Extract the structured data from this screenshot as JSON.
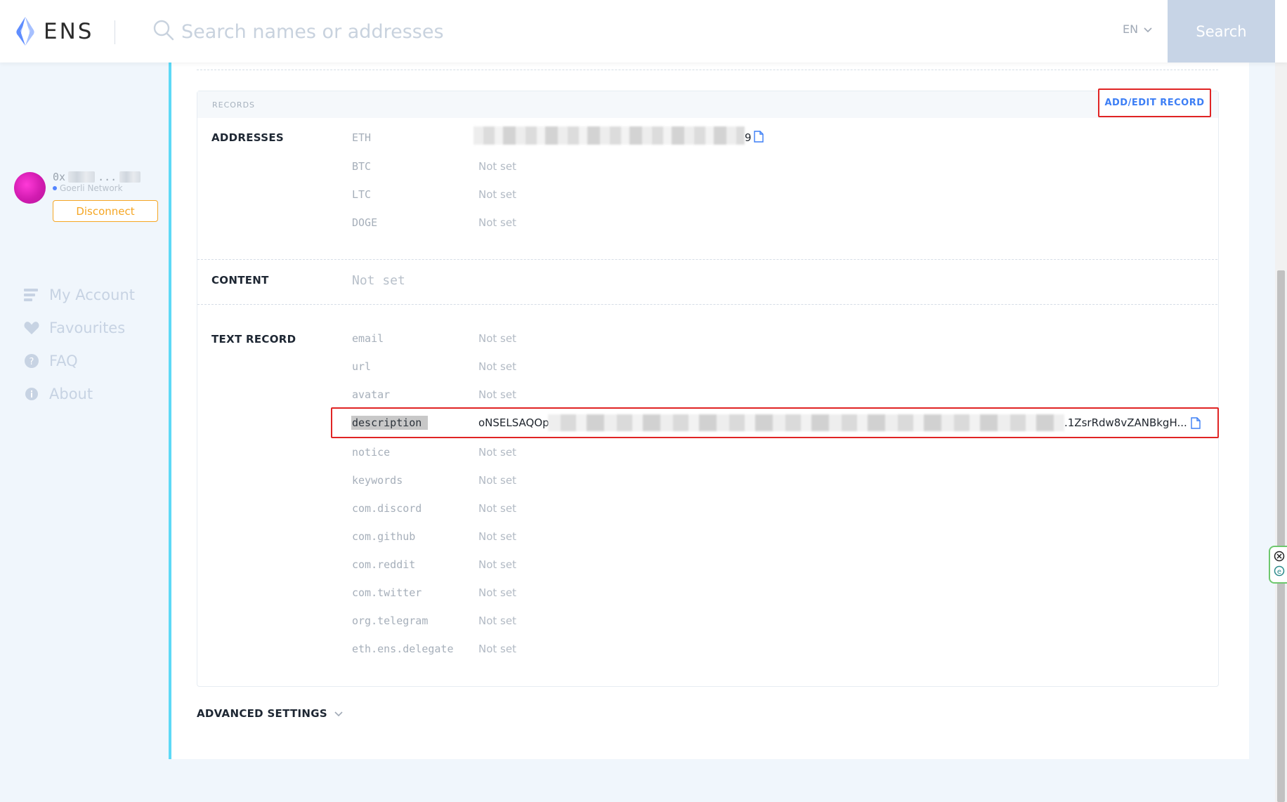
{
  "header": {
    "logo_text": "ENS",
    "search_placeholder": "Search names or addresses",
    "language": "EN",
    "search_button": "Search"
  },
  "account": {
    "address_prefix": "0x",
    "address_sep": "...",
    "network": "Goerli Network",
    "disconnect_label": "Disconnect"
  },
  "sidebar": {
    "items": [
      {
        "label": "My Account",
        "icon": "list-icon"
      },
      {
        "label": "Favourites",
        "icon": "heart-icon"
      },
      {
        "label": "FAQ",
        "icon": "question-icon"
      },
      {
        "label": "About",
        "icon": "info-icon"
      }
    ]
  },
  "records": {
    "section_label": "RECORDS",
    "add_edit_label": "ADD/EDIT RECORD",
    "addresses": {
      "title": "ADDRESSES",
      "items": [
        {
          "key": "ETH",
          "value": "9"
        },
        {
          "key": "BTC",
          "value": "Not set"
        },
        {
          "key": "LTC",
          "value": "Not set"
        },
        {
          "key": "DOGE",
          "value": "Not set"
        }
      ]
    },
    "content": {
      "title": "CONTENT",
      "value": "Not set"
    },
    "text_record": {
      "title": "TEXT RECORD",
      "items": [
        {
          "key": "email",
          "value": "Not set"
        },
        {
          "key": "url",
          "value": "Not set"
        },
        {
          "key": "avatar",
          "value": "Not set"
        },
        {
          "key": "description",
          "value_start": "oNSELSAQOp",
          "value_end": ".1ZsrRdw8vZANBkgH..."
        },
        {
          "key": "notice",
          "value": "Not set"
        },
        {
          "key": "keywords",
          "value": "Not set"
        },
        {
          "key": "com.discord",
          "value": "Not set"
        },
        {
          "key": "com.github",
          "value": "Not set"
        },
        {
          "key": "com.reddit",
          "value": "Not set"
        },
        {
          "key": "com.twitter",
          "value": "Not set"
        },
        {
          "key": "org.telegram",
          "value": "Not set"
        },
        {
          "key": "eth.ens.delegate",
          "value": "Not set"
        }
      ]
    }
  },
  "advanced_settings_label": "ADVANCED SETTINGS",
  "colors": {
    "accent_blue": "#3c7ef5",
    "highlight_red": "#e02424",
    "disconnect_orange": "#f5a623",
    "panel_border_cyan": "#5dd9f6"
  }
}
